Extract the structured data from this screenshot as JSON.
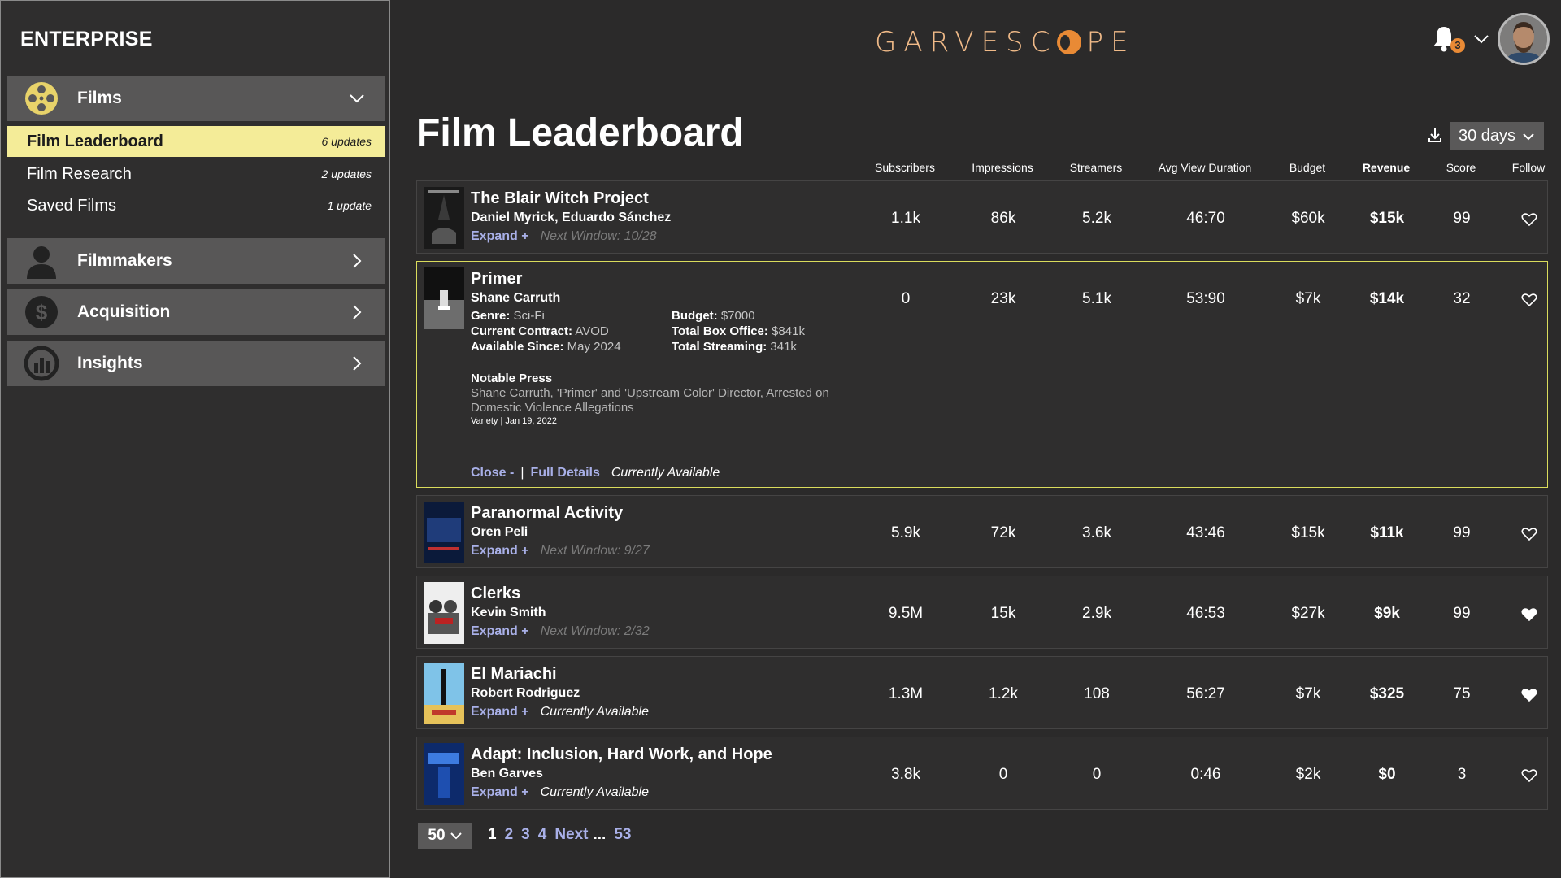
{
  "sidebar": {
    "brand": "ENTERPRISE",
    "sections": [
      {
        "label": "Films",
        "icon": "film-reel-icon"
      },
      {
        "label": "Filmmakers",
        "icon": "person-icon"
      },
      {
        "label": "Acquisition",
        "icon": "dollar-icon"
      },
      {
        "label": "Insights",
        "icon": "analytics-icon"
      }
    ],
    "film_items": [
      {
        "label": "Film Leaderboard",
        "count": "6 updates",
        "active": true
      },
      {
        "label": "Film Research",
        "count": "2 updates"
      },
      {
        "label": "Saved Films",
        "count": "1 update"
      }
    ]
  },
  "header": {
    "logo": "GARVESC",
    "logo_tail": "PE",
    "notification_count": "3"
  },
  "page": {
    "title": "Film Leaderboard",
    "period": "30 days"
  },
  "columns": [
    "Subscribers",
    "Impressions",
    "Streamers",
    "Avg View Duration",
    "Budget",
    "Revenue",
    "Score",
    "Follow"
  ],
  "films": [
    {
      "title": "The Blair Witch Project",
      "director": "Daniel Myrick, Eduardo Sánchez",
      "link": "Expand +",
      "status": "Next Window: 10/28",
      "subscribers": "1.1k",
      "impressions": "86k",
      "streamers": "5.2k",
      "avg_view": "46:70",
      "budget": "$60k",
      "revenue": "$15k",
      "score": "99",
      "followed": false
    },
    {
      "title": "Primer",
      "director": "Shane Carruth",
      "subscribers": "0",
      "impressions": "23k",
      "streamers": "5.1k",
      "avg_view": "53:90",
      "budget": "$7k",
      "revenue": "$14k",
      "score": "32",
      "followed": false,
      "details": {
        "genre_label": "Genre:",
        "genre": "Sci-Fi",
        "contract_label": "Current Contract:",
        "contract": "AVOD",
        "available_label": "Available Since:",
        "available": "May 2024",
        "budget_label": "Budget:",
        "budget": "$7000",
        "box_office_label": "Total Box Office:",
        "box_office": "$841k",
        "streaming_label": "Total Streaming:",
        "streaming": "341k",
        "press_heading": "Notable Press",
        "press_line1": "Shane Carruth, 'Primer' and 'Upstream Color' Director, Arrested on",
        "press_line2": "Domestic Violence Allegations",
        "press_source": "Variety | Jan 19, 2022",
        "close_label": "Close -",
        "separator": "|",
        "full_details_label": "Full Details",
        "status": "Currently Available"
      }
    },
    {
      "title": "Paranormal Activity",
      "director": "Oren Peli",
      "link": "Expand +",
      "status": "Next Window: 9/27",
      "subscribers": "5.9k",
      "impressions": "72k",
      "streamers": "3.6k",
      "avg_view": "43:46",
      "budget": "$15k",
      "revenue": "$11k",
      "score": "99",
      "followed": false
    },
    {
      "title": "Clerks",
      "director": "Kevin Smith",
      "link": "Expand +",
      "status": "Next Window: 2/32",
      "subscribers": "9.5M",
      "impressions": "15k",
      "streamers": "2.9k",
      "avg_view": "46:53",
      "budget": "$27k",
      "revenue": "$9k",
      "score": "99",
      "followed": true
    },
    {
      "title": "El Mariachi",
      "director": "Robert Rodriguez",
      "link": "Expand +",
      "status": "Currently Available",
      "subscribers": "1.3M",
      "impressions": "1.2k",
      "streamers": "108",
      "avg_view": "56:27",
      "budget": "$7k",
      "revenue": "$325",
      "score": "75",
      "followed": true
    },
    {
      "title": "Adapt: Inclusion, Hard Work, and Hope",
      "director": "Ben Garves",
      "link": "Expand +",
      "status": "Currently Available",
      "subscribers": "3.8k",
      "impressions": "0",
      "streamers": "0",
      "avg_view": "0:46",
      "budget": "$2k",
      "revenue": "$0",
      "score": "3",
      "followed": false
    }
  ],
  "pagination": {
    "per_page": "50",
    "pages": [
      "1",
      "2",
      "3",
      "4"
    ],
    "next": "Next",
    "ellipsis": "...",
    "last": "53"
  },
  "colors": {
    "accent_yellow": "#f4ec98",
    "expanded_border": "#dadc5c",
    "link": "#a9b0e8",
    "logo": "#f0ba88",
    "logo_dot": "#e98a35"
  }
}
